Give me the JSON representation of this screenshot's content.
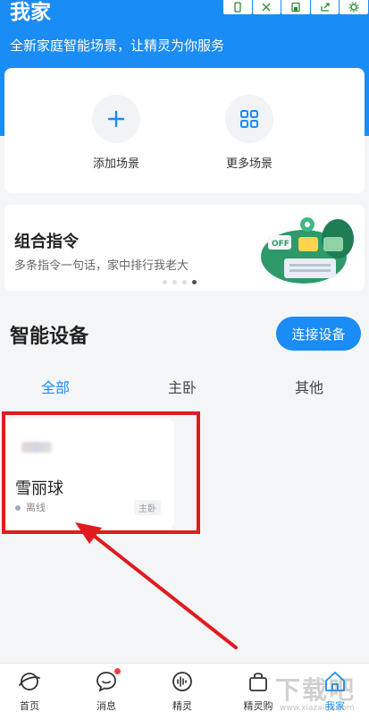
{
  "header": {
    "title": "我家",
    "subtitle": "全新家庭智能场景，让精灵为你服务",
    "icons": [
      "phone-icon",
      "expand-icon",
      "save-icon",
      "share-icon",
      "settings-icon"
    ]
  },
  "scenes": {
    "add": {
      "label": "添加场景",
      "icon": "plus-icon"
    },
    "more": {
      "label": "更多场景",
      "icon": "grid-icon"
    }
  },
  "combo": {
    "title": "组合指令",
    "subtitle": "多条指令一句话，家中排行我老大",
    "illustration_tag": "OFF",
    "pages": 4,
    "active_page": 3
  },
  "devices": {
    "section_title": "智能设备",
    "connect_label": "连接设备",
    "tabs": [
      {
        "label": "全部",
        "active": true
      },
      {
        "label": "主卧",
        "active": false
      },
      {
        "label": "其他",
        "active": false
      }
    ],
    "items": [
      {
        "name": "雪丽球",
        "status": "离线",
        "room": "主卧"
      }
    ]
  },
  "bottom_nav": [
    {
      "label": "首页",
      "icon": "planet-icon",
      "active": false
    },
    {
      "label": "消息",
      "icon": "chat-bubble-icon",
      "active": false,
      "badge": true
    },
    {
      "label": "精灵",
      "icon": "voice-wave-icon",
      "active": false
    },
    {
      "label": "精灵购",
      "icon": "shopping-bag-icon",
      "active": false
    },
    {
      "label": "我家",
      "icon": "home-icon",
      "active": true
    }
  ],
  "watermark": {
    "text": "下载吧",
    "url": "www.xiazaiba.com"
  },
  "colors": {
    "brand_blue": "#1a8cf5",
    "highlight_red": "#e01b1f",
    "badge_red": "#f5413b",
    "background": "#f4f5f7"
  }
}
